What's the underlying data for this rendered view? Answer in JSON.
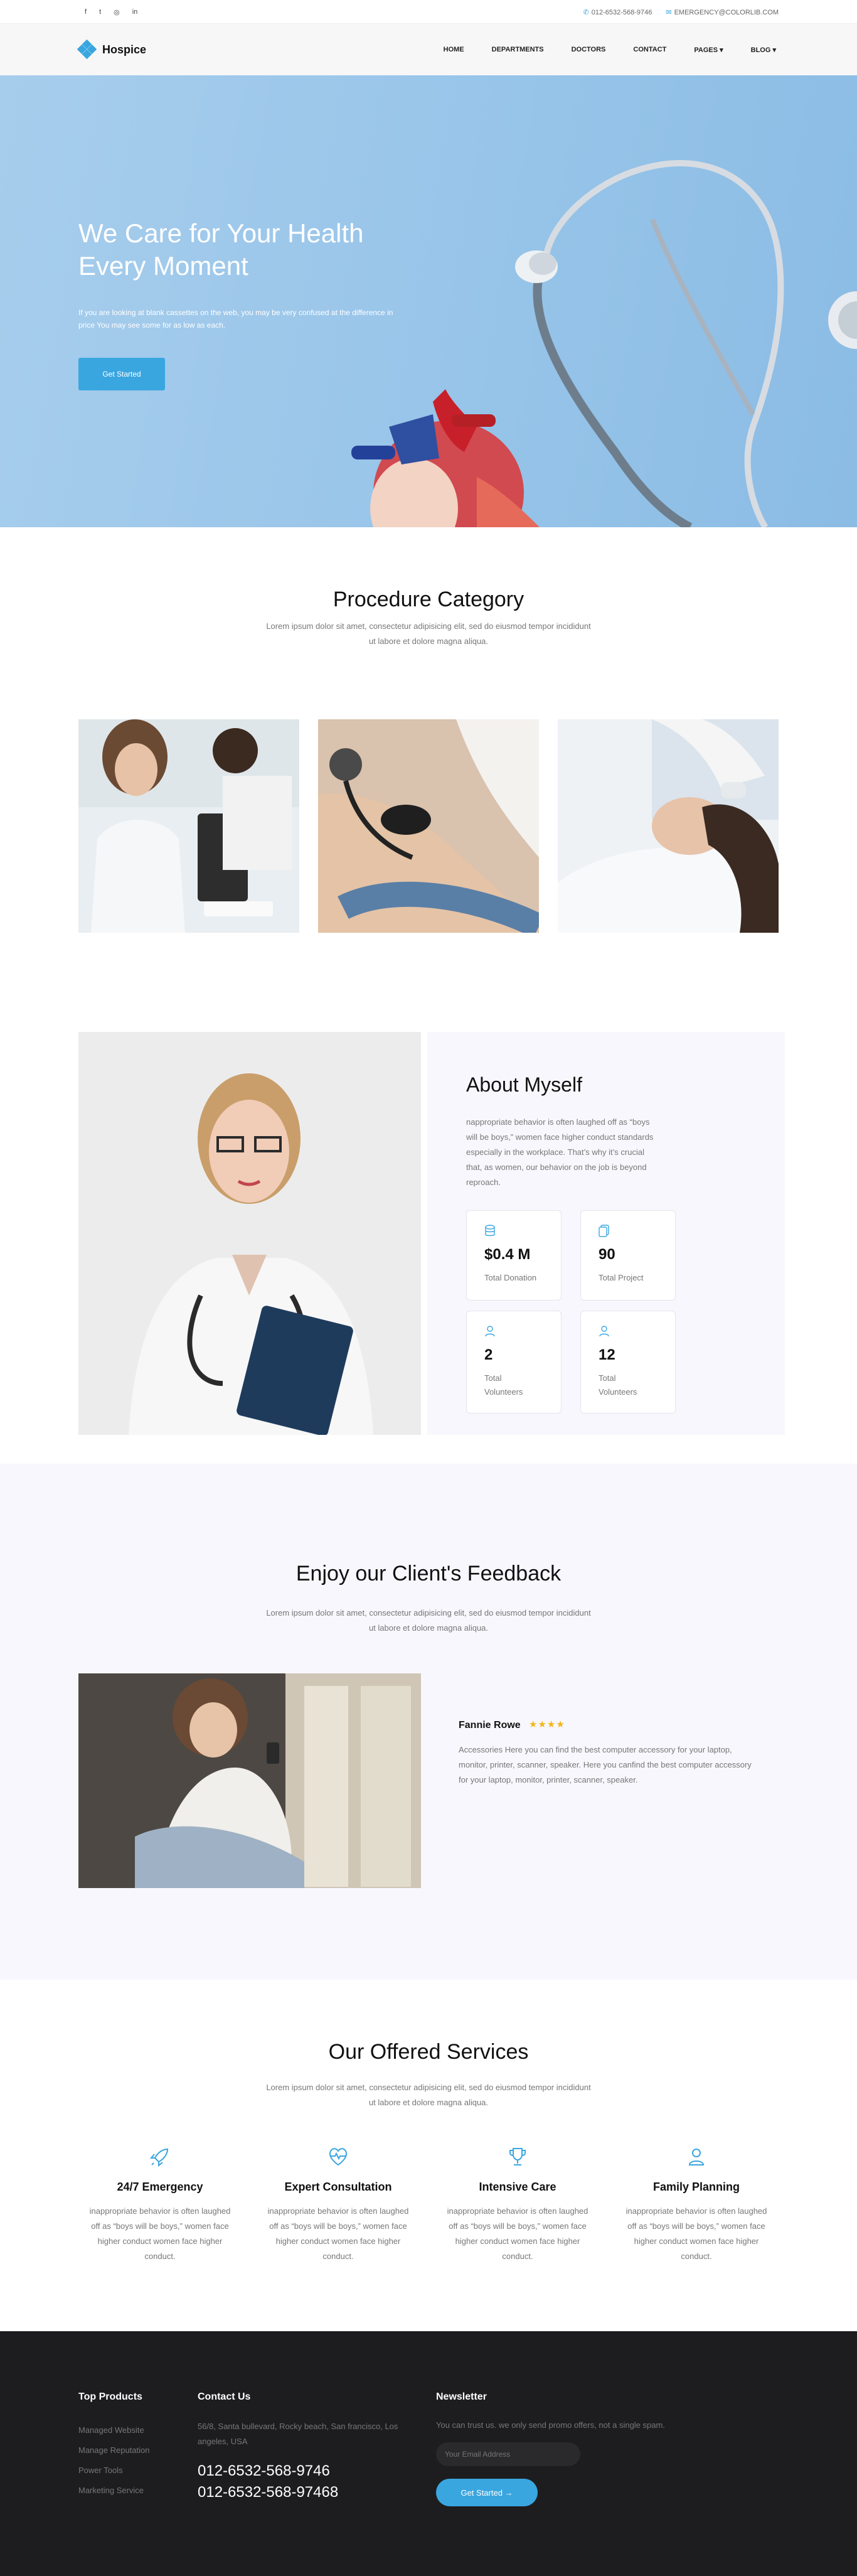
{
  "topbar": {
    "social": [
      "f",
      "t",
      "◎",
      "in"
    ],
    "phone": "012-6532-568-9746",
    "email": "EMERGENCY@COLORLIB.COM"
  },
  "brand": {
    "name": "Hospice"
  },
  "nav": {
    "items": [
      "HOME",
      "DEPARTMENTS",
      "DOCTORS",
      "CONTACT",
      "PAGES ▾",
      "BLOG ▾"
    ]
  },
  "hero": {
    "title": "We Care for Your Health Every Moment",
    "text": "If you are looking at blank cassettes on the web, you may be very confused at the difference in price You may see some for as low as each.",
    "button": "Get Started"
  },
  "procedure": {
    "title": "Procedure Category",
    "subtitle": "Lorem ipsum dolor sit amet, consectetur adipisicing elit, sed do eiusmod tempor incididunt ut labore et dolore magna aliqua."
  },
  "about": {
    "title": "About Myself",
    "text": "nappropriate behavior is often laughed off as “boys will be boys,” women face higher conduct standards especially in the workplace. That’s why it’s crucial that, as women, our behavior on the job is beyond reproach.",
    "stats": [
      {
        "icon": "database-icon",
        "value": "$0.4 M",
        "label": "Total Donation"
      },
      {
        "icon": "document-icon",
        "value": "90",
        "label": "Total Project"
      },
      {
        "icon": "user-icon",
        "value": "2",
        "label": "Total Volunteers"
      },
      {
        "icon": "user-icon",
        "value": "12",
        "label": "Total Volunteers"
      }
    ]
  },
  "feedback": {
    "title": "Enjoy our Client's Feedback",
    "subtitle": "Lorem ipsum dolor sit amet, consectetur adipisicing elit, sed do eiusmod tempor incididunt ut labore et dolore magna aliqua.",
    "name": "Fannie Rowe",
    "rating": 4,
    "stars": "★★★★",
    "text": "Accessories Here you can find the best computer accessory for your laptop, monitor, printer, scanner, speaker. Here you canfind the best computer accessory for your laptop, monitor, printer, scanner, speaker."
  },
  "services": {
    "title": "Our Offered Services",
    "subtitle": "Lorem ipsum dolor sit amet, consectetur adipisicing elit, sed do eiusmod tempor incididunt ut labore et dolore magna aliqua.",
    "items": [
      {
        "icon": "rocket-icon",
        "title": "24/7 Emergency",
        "text": "inappropriate behavior is often laughed off as “boys will be boys,” women face higher conduct women face higher conduct."
      },
      {
        "icon": "heartbeat-icon",
        "title": "Expert Consultation",
        "text": "inappropriate behavior is often laughed off as “boys will be boys,” women face higher conduct women face higher conduct."
      },
      {
        "icon": "trophy-icon",
        "title": "Intensive Care",
        "text": "inappropriate behavior is often laughed off as “boys will be boys,” women face higher conduct women face higher conduct."
      },
      {
        "icon": "user-icon",
        "title": "Family Planning",
        "text": "inappropriate behavior is often laughed off as “boys will be boys,” women face higher conduct women face higher conduct."
      }
    ]
  },
  "footer": {
    "products_title": "Top Products",
    "products": [
      "Managed Website",
      "Manage Reputation",
      "Power Tools",
      "Marketing Service"
    ],
    "contact_title": "Contact Us",
    "address": "56/8, Santa bullevard, Rocky beach, San francisco, Los angeles, USA",
    "phone1": "012-6532-568-9746",
    "phone2": "012-6532-568-97468",
    "newsletter_title": "Newsletter",
    "newsletter_text": "You can trust us. we only send promo offers, not a single spam.",
    "email_placeholder": "Your Email Address",
    "button": "Get Started →"
  },
  "colors": {
    "accent": "#3aa6e0",
    "footer": "#1d1d1f",
    "panel": "#f8f7fd"
  }
}
